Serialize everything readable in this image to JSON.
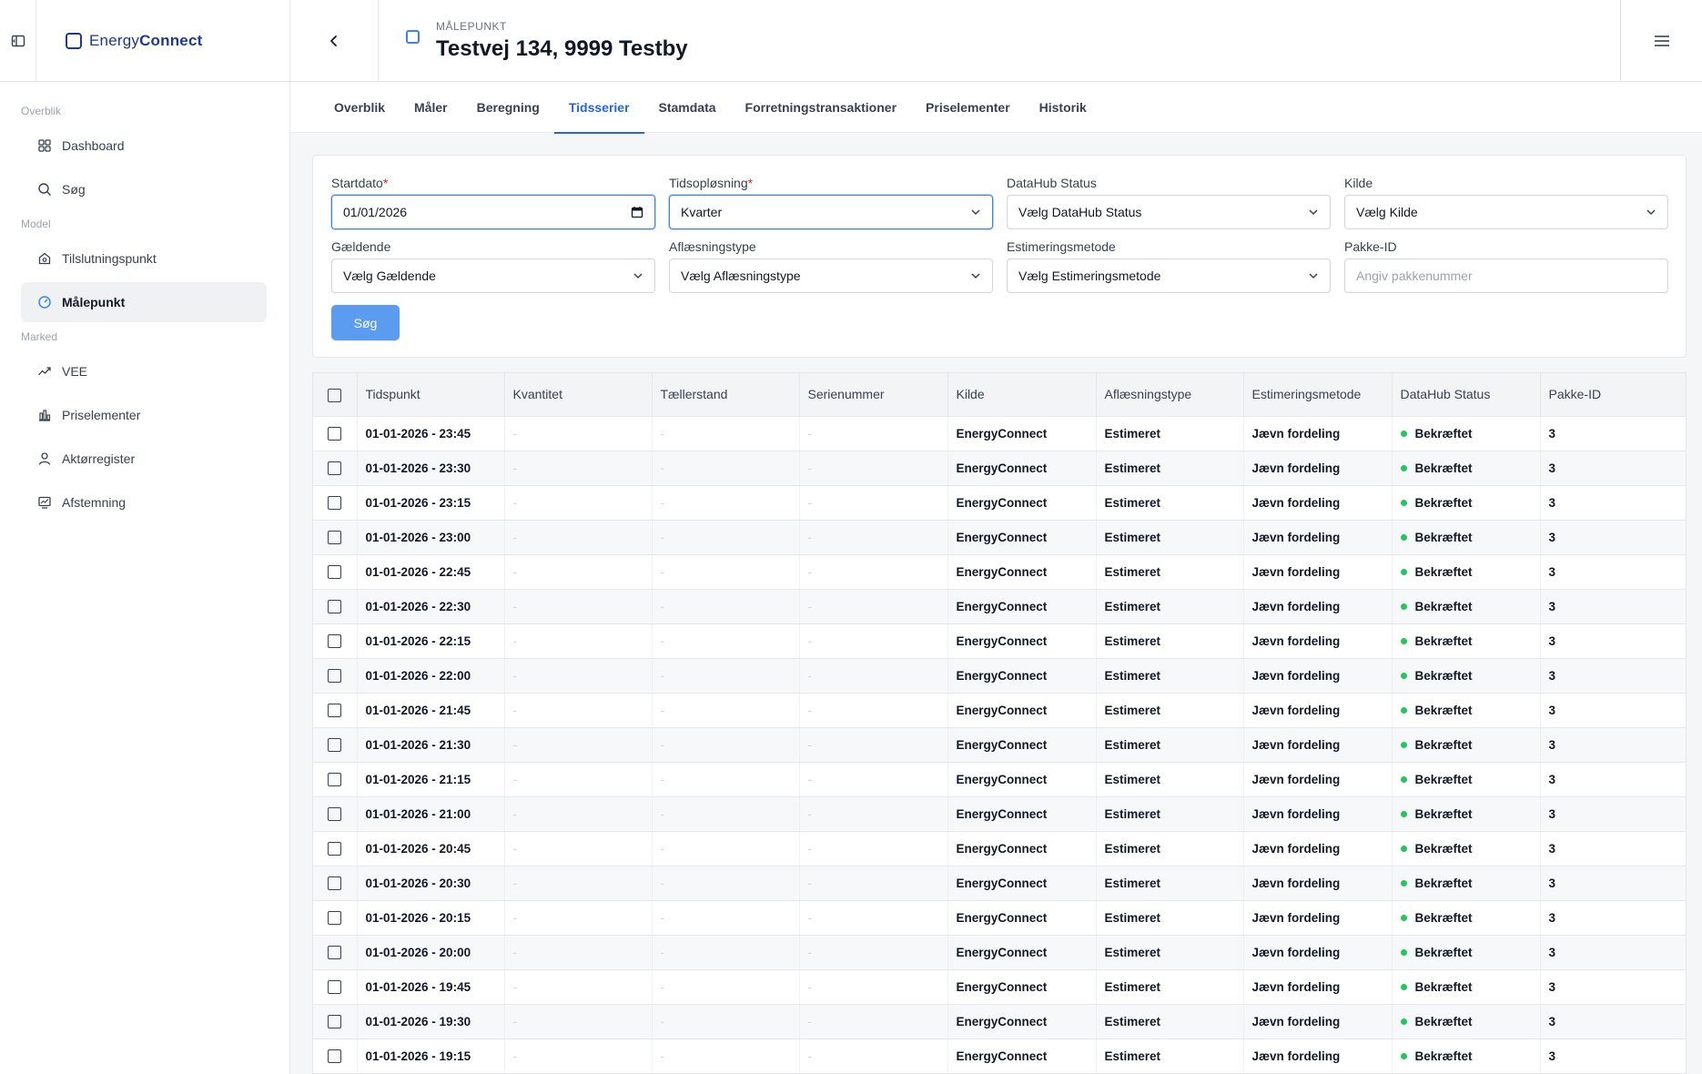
{
  "brand": {
    "part1": "Energy",
    "part2": "Connect"
  },
  "sidebar": {
    "sections": [
      {
        "label": "Overblik",
        "items": [
          {
            "label": "Dashboard",
            "icon": "grid-icon"
          },
          {
            "label": "Søg",
            "icon": "search-icon"
          }
        ]
      },
      {
        "label": "Model",
        "items": [
          {
            "label": "Tilslutningspunkt",
            "icon": "house-icon"
          },
          {
            "label": "Målepunkt",
            "icon": "gauge-icon",
            "active": true
          }
        ]
      },
      {
        "label": "Marked",
        "items": [
          {
            "label": "VEE",
            "icon": "trend-icon"
          },
          {
            "label": "Priselementer",
            "icon": "bar-chart-icon"
          },
          {
            "label": "Aktørregister",
            "icon": "user-icon"
          },
          {
            "label": "Afstemning",
            "icon": "monitor-chart-icon"
          }
        ]
      }
    ]
  },
  "header": {
    "subtitle": "MÅLEPUNKT",
    "title": "Testvej 134, 9999 Testby"
  },
  "tabs": [
    "Overblik",
    "Måler",
    "Beregning",
    "Tidsserier",
    "Stamdata",
    "Forretningstransaktioner",
    "Priselementer",
    "Historik"
  ],
  "active_tab": "Tidsserier",
  "filters": {
    "startdato": {
      "label": "Startdato",
      "value": "01/01/2026"
    },
    "tidsoploesning": {
      "label": "Tidsopløsning",
      "value": "Kvarter"
    },
    "datahub_status": {
      "label": "DataHub Status",
      "value": "Vælg DataHub Status"
    },
    "kilde": {
      "label": "Kilde",
      "value": "Vælg Kilde"
    },
    "gaeldende": {
      "label": "Gældende",
      "value": "Vælg Gældende"
    },
    "aflaesningstype": {
      "label": "Aflæsningstype",
      "value": "Vælg Aflæsningstype"
    },
    "estimeringsmetode": {
      "label": "Estimeringsmetode",
      "value": "Vælg Estimeringsmetode"
    },
    "pakke_id": {
      "label": "Pakke-ID",
      "placeholder": "Angiv pakkenummer"
    },
    "search_button": "Søg"
  },
  "table": {
    "columns": [
      "Tidspunkt",
      "Kvantitet",
      "Tællerstand",
      "Serienummer",
      "Kilde",
      "Aflæsningstype",
      "Estimeringsmetode",
      "DataHub Status",
      "Pakke-ID"
    ],
    "status_color": "#22c55e",
    "rows": [
      [
        "01-01-2026 - 23:45",
        "-",
        "-",
        "-",
        "EnergyConnect",
        "Estimeret",
        "Jævn fordeling",
        "Bekræftet",
        "3"
      ],
      [
        "01-01-2026 - 23:30",
        "-",
        "-",
        "-",
        "EnergyConnect",
        "Estimeret",
        "Jævn fordeling",
        "Bekræftet",
        "3"
      ],
      [
        "01-01-2026 - 23:15",
        "-",
        "-",
        "-",
        "EnergyConnect",
        "Estimeret",
        "Jævn fordeling",
        "Bekræftet",
        "3"
      ],
      [
        "01-01-2026 - 23:00",
        "-",
        "-",
        "-",
        "EnergyConnect",
        "Estimeret",
        "Jævn fordeling",
        "Bekræftet",
        "3"
      ],
      [
        "01-01-2026 - 22:45",
        "-",
        "-",
        "-",
        "EnergyConnect",
        "Estimeret",
        "Jævn fordeling",
        "Bekræftet",
        "3"
      ],
      [
        "01-01-2026 - 22:30",
        "-",
        "-",
        "-",
        "EnergyConnect",
        "Estimeret",
        "Jævn fordeling",
        "Bekræftet",
        "3"
      ],
      [
        "01-01-2026 - 22:15",
        "-",
        "-",
        "-",
        "EnergyConnect",
        "Estimeret",
        "Jævn fordeling",
        "Bekræftet",
        "3"
      ],
      [
        "01-01-2026 - 22:00",
        "-",
        "-",
        "-",
        "EnergyConnect",
        "Estimeret",
        "Jævn fordeling",
        "Bekræftet",
        "3"
      ],
      [
        "01-01-2026 - 21:45",
        "-",
        "-",
        "-",
        "EnergyConnect",
        "Estimeret",
        "Jævn fordeling",
        "Bekræftet",
        "3"
      ],
      [
        "01-01-2026 - 21:30",
        "-",
        "-",
        "-",
        "EnergyConnect",
        "Estimeret",
        "Jævn fordeling",
        "Bekræftet",
        "3"
      ],
      [
        "01-01-2026 - 21:15",
        "-",
        "-",
        "-",
        "EnergyConnect",
        "Estimeret",
        "Jævn fordeling",
        "Bekræftet",
        "3"
      ],
      [
        "01-01-2026 - 21:00",
        "-",
        "-",
        "-",
        "EnergyConnect",
        "Estimeret",
        "Jævn fordeling",
        "Bekræftet",
        "3"
      ],
      [
        "01-01-2026 - 20:45",
        "-",
        "-",
        "-",
        "EnergyConnect",
        "Estimeret",
        "Jævn fordeling",
        "Bekræftet",
        "3"
      ],
      [
        "01-01-2026 - 20:30",
        "-",
        "-",
        "-",
        "EnergyConnect",
        "Estimeret",
        "Jævn fordeling",
        "Bekræftet",
        "3"
      ],
      [
        "01-01-2026 - 20:15",
        "-",
        "-",
        "-",
        "EnergyConnect",
        "Estimeret",
        "Jævn fordeling",
        "Bekræftet",
        "3"
      ],
      [
        "01-01-2026 - 20:00",
        "-",
        "-",
        "-",
        "EnergyConnect",
        "Estimeret",
        "Jævn fordeling",
        "Bekræftet",
        "3"
      ],
      [
        "01-01-2026 - 19:45",
        "-",
        "-",
        "-",
        "EnergyConnect",
        "Estimeret",
        "Jævn fordeling",
        "Bekræftet",
        "3"
      ],
      [
        "01-01-2026 - 19:30",
        "-",
        "-",
        "-",
        "EnergyConnect",
        "Estimeret",
        "Jævn fordeling",
        "Bekræftet",
        "3"
      ],
      [
        "01-01-2026 - 19:15",
        "-",
        "-",
        "-",
        "EnergyConnect",
        "Estimeret",
        "Jævn fordeling",
        "Bekræftet",
        "3"
      ]
    ]
  }
}
